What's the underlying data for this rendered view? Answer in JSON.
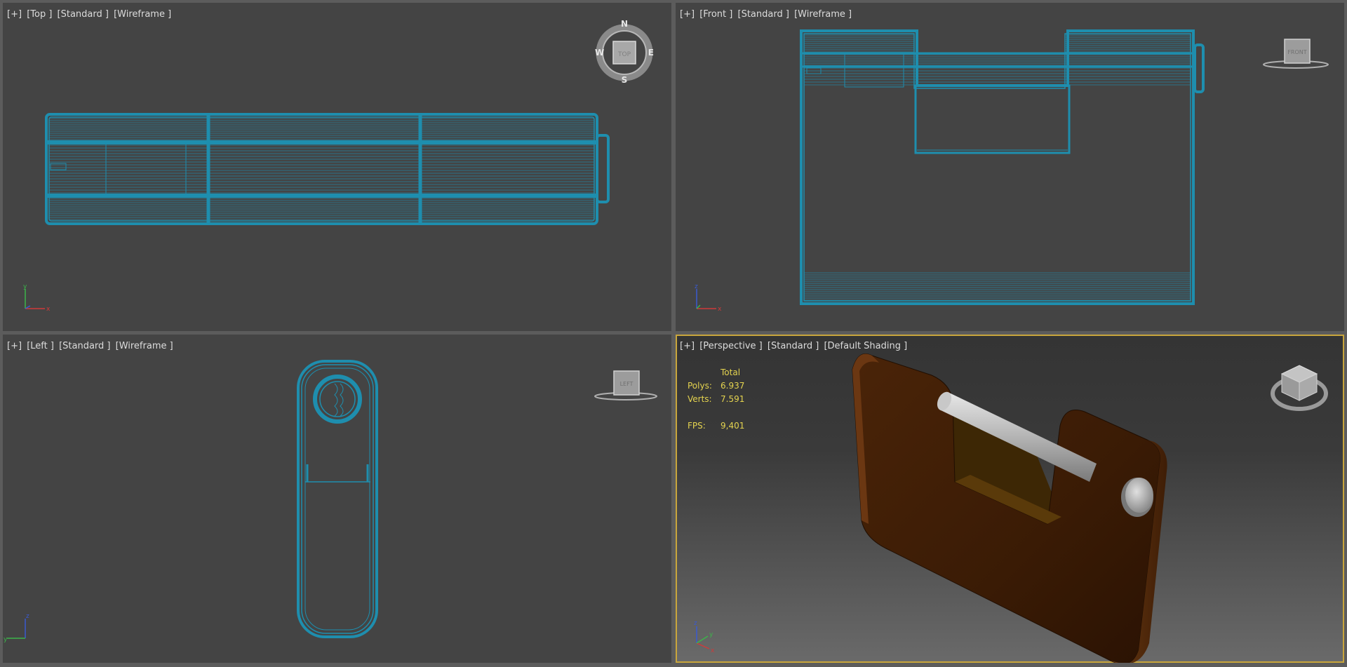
{
  "viewports": {
    "top": {
      "label_parts": [
        "[+]",
        "[Top ]",
        "[Standard ]",
        "[Wireframe ]"
      ],
      "axis_labels": {
        "h": "x",
        "v": "y"
      }
    },
    "front": {
      "label_parts": [
        "[+]",
        "[Front ]",
        "[Standard ]",
        "[Wireframe ]"
      ],
      "axis_labels": {
        "h": "x",
        "v": "z"
      }
    },
    "left": {
      "label_parts": [
        "[+]",
        "[Left ]",
        "[Standard ]",
        "[Wireframe ]"
      ],
      "axis_labels": {
        "h": "y",
        "v": "z"
      }
    },
    "perspective": {
      "label_parts": [
        "[+]",
        "[Perspective ]",
        "[Standard ]",
        "[Default Shading ]"
      ],
      "axis_labels": {
        "h": "x",
        "v": "z",
        "d": "y"
      },
      "stats": {
        "header": "Total",
        "polys_label": "Polys:",
        "polys": "6.937",
        "verts_label": "Verts:",
        "verts": "7.591",
        "fps_label": "FPS:",
        "fps": "9,401"
      }
    }
  },
  "viewcube": {
    "compass": {
      "n": "N",
      "s": "S",
      "e": "E",
      "w": "W"
    },
    "top_face": "TOP",
    "front_face": "FRONT",
    "left_face": "LEFT"
  },
  "colors": {
    "viewport_bg": "#444444",
    "wireframe": "#1e8eae",
    "active_border": "#c9a63c",
    "stats_text": "#e4d34f",
    "padlock_body": "#5a2e0c",
    "shackle": "#b8b8b8"
  }
}
